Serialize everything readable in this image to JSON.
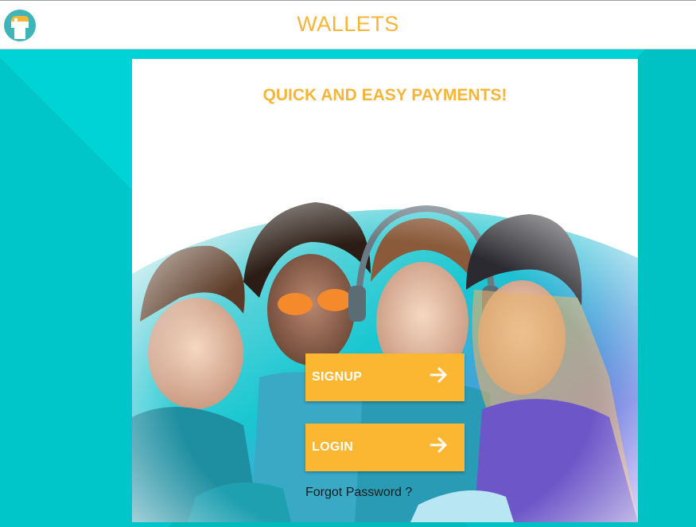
{
  "header": {
    "title": "WALLETS",
    "logo_icon": "wallet-app-icon"
  },
  "hero": {
    "tagline": "QUICK AND EASY PAYMENTS!",
    "image": "group-of-friends-smiling-at-phone-photo"
  },
  "actions": {
    "signup_label": "SIGNUP",
    "login_label": "LOGIN",
    "arrow_icon": "arrow-right-icon",
    "forgot_password_label": "Forgot Password ?"
  },
  "colors": {
    "accent": "#f7b538",
    "button": "#fbb632",
    "background": "#00c9cc",
    "header_bg": "#ffffff"
  }
}
